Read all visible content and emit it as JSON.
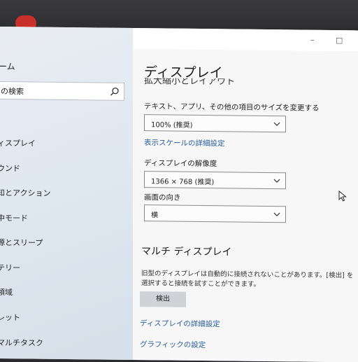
{
  "window": {
    "minimize_label": "–",
    "maximize_label": "□"
  },
  "sidebar": {
    "home_label": "ーム",
    "search_text": "の検索",
    "items": [
      {
        "label": "ィスプレイ"
      },
      {
        "label": "ウンド"
      },
      {
        "label": "知とアクション"
      },
      {
        "label": "中モード"
      },
      {
        "label": "源とスリープ"
      },
      {
        "label": "テリー"
      },
      {
        "label": "領域"
      },
      {
        "label": "レット"
      },
      {
        "label": "マルチタスク"
      }
    ]
  },
  "main": {
    "title": "ディスプレイ",
    "scale_heading_partial": "拡大縮小とレイアウト",
    "scale_label": "テキスト、アプリ、その他の項目のサイズを変更する",
    "scale_value": "100% (推奨)",
    "advanced_scale_link": "表示スケールの詳細設定",
    "resolution_label": "ディスプレイの解像度",
    "resolution_value": "1366 × 768 (推奨)",
    "orientation_label": "画面の向き",
    "orientation_value": "横",
    "multi_display_title": "マルチ ディスプレイ",
    "multi_display_desc": "旧型のディスプレイは自動的に接続されないことがあります。[検出] を選択すると接続を試すことができます。",
    "detect_button": "検出",
    "advanced_display_link": "ディスプレイの詳細設定",
    "graphics_link": "グラフィックの設定"
  },
  "colors": {
    "link": "#2b5f9e",
    "sidebar_bg": "#e2e8ef",
    "content_bg": "#f7f7f8"
  }
}
